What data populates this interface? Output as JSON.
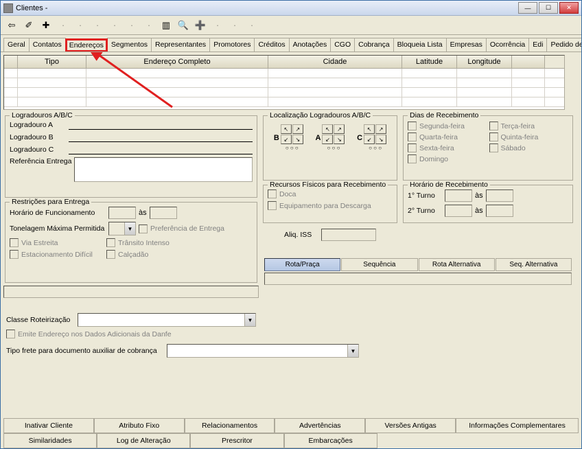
{
  "window": {
    "title": "Clientes -"
  },
  "toolbar_icons": [
    "⇦",
    "✐",
    "✚",
    "·",
    "·",
    "·",
    "·",
    "·",
    "·",
    "▥",
    "🔍",
    "➕",
    "·",
    "·",
    "·"
  ],
  "tabs": [
    "Geral",
    "Contatos",
    "Endereços",
    "Segmentos",
    "Representantes",
    "Promotores",
    "Créditos",
    "Anotações",
    "CGO",
    "Cobrança",
    "Bloqueia Lista",
    "Empresas",
    "Ocorrência",
    "Edi",
    "Pedido de Venda"
  ],
  "active_tab_index": 2,
  "grid_headers": {
    "tipo": "Tipo",
    "endereco": "Endereço Completo",
    "cidade": "Cidade",
    "latitude": "Latitude",
    "longitude": "Longitude"
  },
  "logradouros": {
    "legend": "Logradouros A/B/C",
    "a": "Logradouro A",
    "b": "Logradouro B",
    "c": "Logradouro C",
    "ref": "Referência Entrega"
  },
  "restricoes": {
    "legend": "Restrições para Entrega",
    "horario": "Horário de Funcionamento",
    "as": "às",
    "tonelagem": "Tonelagem Máxima Permitida",
    "pref_entrega": "Preferência de Entrega",
    "via_estreita": "Via Estreita",
    "transito": "Trânsito Intenso",
    "estac": "Estacionamento Difícil",
    "calcadao": "Calçadão"
  },
  "localizacao": {
    "legend": "Localização Logradouros A/B/C",
    "b": "B",
    "a": "A",
    "c": "C"
  },
  "recursos": {
    "legend": "Recursos Físicos para Recebimento",
    "doca": "Doca",
    "equip": "Equipamento para Descarga"
  },
  "aliq": {
    "label": "Aliq. ISS"
  },
  "rota_tabs": [
    "Rota/Praça",
    "Sequência",
    "Rota Alternativa",
    "Seq. Alternativa"
  ],
  "dias": {
    "legend": "Dias de Recebimento",
    "seg": "Segunda-feira",
    "ter": "Terça-feira",
    "qua": "Quarta-feira",
    "qui": "Quinta-feira",
    "sex": "Sexta-feira",
    "sab": "Sábado",
    "dom": "Domingo"
  },
  "horario_rec": {
    "legend": "Horário de Recebimento",
    "t1": "1° Turno",
    "t2": "2° Turno",
    "as": "às"
  },
  "classe_rot": "Classe Roteirização",
  "emite_danfe": "Emite Endereço nos Dados Adicionais da Danfe",
  "tipo_frete": "Tipo frete para documento auxiliar de cobrança",
  "bottom_row1": [
    "Inativar Cliente",
    "Atributo Fixo",
    "Relacionamentos",
    "Advertências",
    "Versões Antigas",
    "Informações Complementares"
  ],
  "bottom_row2": [
    "Similaridades",
    "Log de Alteração",
    "Prescritor",
    "Embarcações"
  ]
}
